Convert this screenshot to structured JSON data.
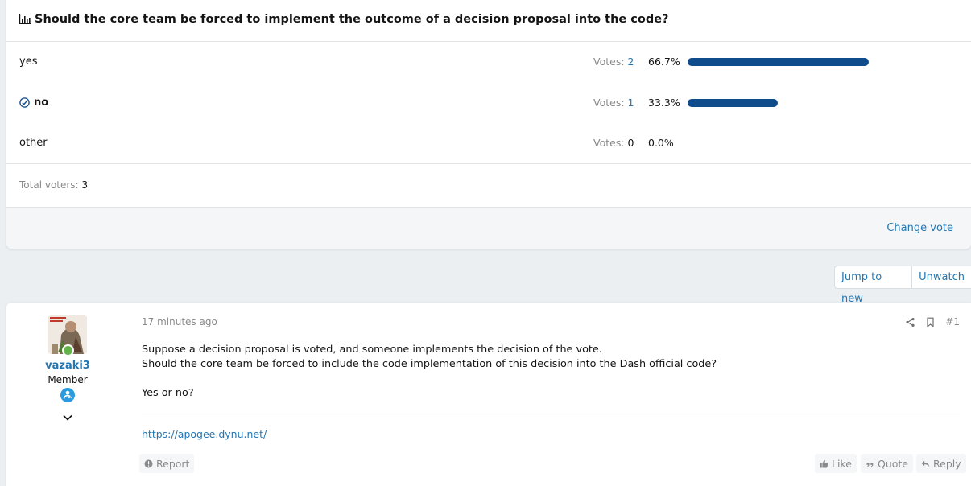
{
  "poll": {
    "question": "Should the core team be forced to implement the outcome of a decision proposal into the code?",
    "votes_label": "Votes:",
    "options": [
      {
        "label": "yes",
        "votes": "2",
        "percent": "66.7%",
        "fraction": 0.667,
        "selected": false
      },
      {
        "label": "no",
        "votes": "1",
        "percent": "33.3%",
        "fraction": 0.333,
        "selected": true
      },
      {
        "label": "other",
        "votes": "0",
        "percent": "0.0%",
        "fraction": 0.0,
        "selected": false
      }
    ],
    "total_label": "Total voters:",
    "total_value": "3",
    "change_vote": "Change vote"
  },
  "thread_actions": {
    "jump_to_new": "Jump to new",
    "unwatch": "Unwatch"
  },
  "post": {
    "username": "vazaki3",
    "role": "Member",
    "time": "17 minutes ago",
    "post_number": "#1",
    "lines": [
      "Suppose a decision proposal is voted, and someone implements the decision of the vote.",
      "Should the core team be forced to include the code implementation of this decision into the Dash official code?",
      "Yes or no?"
    ],
    "signature_link": "https://apogee.dynu.net/",
    "report": "Report",
    "like": "Like",
    "quote": "Quote",
    "reply": "Reply"
  },
  "colors": {
    "accent": "#2577b1",
    "bar": "#0f4c8c",
    "online": "#63b34a",
    "badge": "#2a9be0"
  }
}
